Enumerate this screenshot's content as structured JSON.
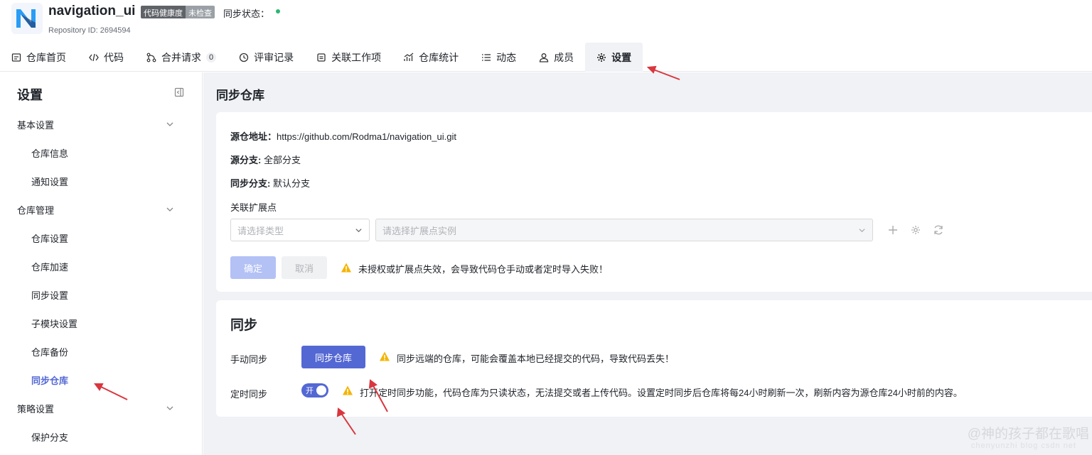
{
  "header": {
    "repo_name": "navigation_ui",
    "health_label": "代码健康度",
    "health_value": "未检查",
    "sync_status_label": "同步状态：",
    "repo_id": "Repository ID: 2694594",
    "logo_letter": "N"
  },
  "tabs": [
    {
      "label": "仓库首页",
      "icon": "file-home-icon"
    },
    {
      "label": "代码",
      "icon": "code-icon"
    },
    {
      "label": "合并请求",
      "icon": "merge-icon",
      "count": "0"
    },
    {
      "label": "评审记录",
      "icon": "review-icon"
    },
    {
      "label": "关联工作项",
      "icon": "workitem-icon"
    },
    {
      "label": "仓库统计",
      "icon": "stats-icon"
    },
    {
      "label": "动态",
      "icon": "activity-icon"
    },
    {
      "label": "成员",
      "icon": "member-icon"
    },
    {
      "label": "设置",
      "icon": "gear-icon",
      "active": true
    }
  ],
  "sidebar": {
    "title": "设置",
    "groups": [
      {
        "label": "基本设置",
        "items": [
          "仓库信息",
          "通知设置"
        ]
      },
      {
        "label": "仓库管理",
        "items": [
          "仓库设置",
          "仓库加速",
          "同步设置",
          "子模块设置",
          "仓库备份",
          "同步仓库"
        ]
      },
      {
        "label": "策略设置",
        "items": [
          "保护分支"
        ]
      }
    ],
    "active_item": "同步仓库"
  },
  "main": {
    "page_title": "同步仓库",
    "source_label": "源仓地址：",
    "source_value": "https://github.com/Rodma1/navigation_ui.git",
    "source_branch_label": "源分支:",
    "source_branch_value": "全部分支",
    "sync_branch_label": "同步分支:",
    "sync_branch_value": "默认分支",
    "ext_label": "关联扩展点",
    "type_placeholder": "请选择类型",
    "instance_placeholder": "请选择扩展点实例",
    "ok_label": "确定",
    "cancel_label": "取消",
    "warn1": "未授权或扩展点失效，会导致代码仓手动或者定时导入失败！",
    "sync_title": "同步",
    "manual_label": "手动同步",
    "sync_button": "同步仓库",
    "warn2": "同步远端的仓库，可能会覆盖本地已经提交的代码，导致代码丢失！",
    "timed_label": "定时同步",
    "toggle_label": "开",
    "warn3": "打开定时同步功能，代码仓库为只读状态，无法提交或者上传代码。设置定时同步后仓库将每24小时刷新一次，刷新内容为源仓库24小时前的内容。"
  },
  "watermark": "@神的孩子都在歌唱",
  "watermark_sub": "chenyunzhi blog csdn net",
  "colors": {
    "accent": "#5468d4",
    "warning": "#f5b400",
    "arrow": "#d9363e"
  }
}
